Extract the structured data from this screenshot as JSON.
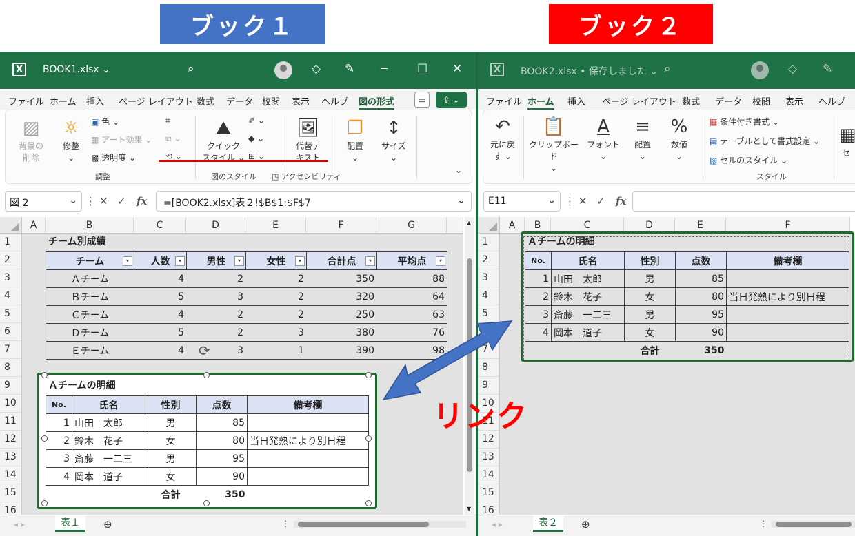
{
  "banners": {
    "book1": "ブック１",
    "book2": "ブック２"
  },
  "link_label": "リンク",
  "book1": {
    "filename": "BOOK1.xlsx ⌄",
    "tabs": [
      "ファイル",
      "ホーム",
      "挿入",
      "ページ レイアウト",
      "数式",
      "データ",
      "校閲",
      "表示",
      "ヘルプ",
      "図の形式"
    ],
    "active_tab": "図の形式",
    "ribbon": {
      "remove_bg": "背景の\n削除",
      "correct": "修整",
      "color": "色 ⌄",
      "art": "アート効果 ⌄",
      "transparency": "透明度 ⌄",
      "group_adjust": "調整",
      "quick_styles": "クイック\nスタイル ⌄",
      "group_styles": "図のスタイル",
      "alt_text": "代替テ\nキスト",
      "group_access": "アクセシビリティ",
      "arrange": "配置",
      "size": "サイズ"
    },
    "namebox": "図 2",
    "formula": "=[BOOK2.xlsx]表２!$B$1:$F$7",
    "columns": [
      "A",
      "B",
      "C",
      "D",
      "E",
      "F",
      "G"
    ],
    "rows": [
      "1",
      "2",
      "3",
      "4",
      "5",
      "6",
      "7",
      "8",
      "9",
      "10",
      "11",
      "12",
      "13",
      "14",
      "15",
      "16"
    ],
    "b1_title": "チーム別成績",
    "team_headers": [
      "チーム",
      "人数",
      "男性",
      "女性",
      "合計点",
      "平均点"
    ],
    "team_rows": [
      [
        "Ａチーム",
        "4",
        "2",
        "2",
        "350",
        "88"
      ],
      [
        "Ｂチーム",
        "5",
        "3",
        "2",
        "320",
        "64"
      ],
      [
        "Ｃチーム",
        "4",
        "2",
        "2",
        "250",
        "63"
      ],
      [
        "Ｄチーム",
        "5",
        "2",
        "3",
        "380",
        "76"
      ],
      [
        "Ｅチーム",
        "4",
        "3",
        "1",
        "390",
        "98"
      ]
    ],
    "sheet_tab": "表１"
  },
  "detail": {
    "title": "Ａチームの明細",
    "headers": [
      "No.",
      "氏名",
      "性別",
      "点数",
      "備考欄"
    ],
    "rows": [
      [
        "1",
        "山田　太郎",
        "男",
        "85",
        ""
      ],
      [
        "2",
        "鈴木　花子",
        "女",
        "80",
        "当日発熱により別日程"
      ],
      [
        "3",
        "斎藤　一二三",
        "男",
        "95",
        ""
      ],
      [
        "4",
        "岡本　道子",
        "女",
        "90",
        ""
      ]
    ],
    "total_label": "合計",
    "total_value": "350"
  },
  "book2": {
    "filename": "BOOK2.xlsx • 保存しました ⌄",
    "tabs": [
      "ファイル",
      "ホーム",
      "挿入",
      "ページ レイアウト",
      "数式",
      "データ",
      "校閲",
      "表示",
      "ヘルプ"
    ],
    "active_tab": "ホーム",
    "ribbon": {
      "undo": "元に戻\nす ⌄",
      "clipboard": "クリップボード\n⌄",
      "font": "フォント\n⌄",
      "align": "配置\n⌄",
      "number": "数値\n⌄",
      "cond": "条件付き書式 ⌄",
      "as_table": "テーブルとして書式設定 ⌄",
      "cell_style": "セルのスタイル ⌄",
      "group_style": "スタイル",
      "cells_cut": "セ"
    },
    "namebox": "E11",
    "columns": [
      "A",
      "B",
      "C",
      "D",
      "E",
      "F"
    ],
    "rows": [
      "1",
      "2",
      "3",
      "4",
      "5",
      "6",
      "7",
      "8",
      "9",
      "10",
      "11",
      "12",
      "13",
      "14",
      "15",
      "16"
    ],
    "sheet_tab": "表２"
  },
  "colors": {
    "excel_green": "#1f7246",
    "banner1": "#4472c4",
    "banner2": "#ff0000",
    "arrow": "#4472c4",
    "link_text": "#ff0000"
  }
}
